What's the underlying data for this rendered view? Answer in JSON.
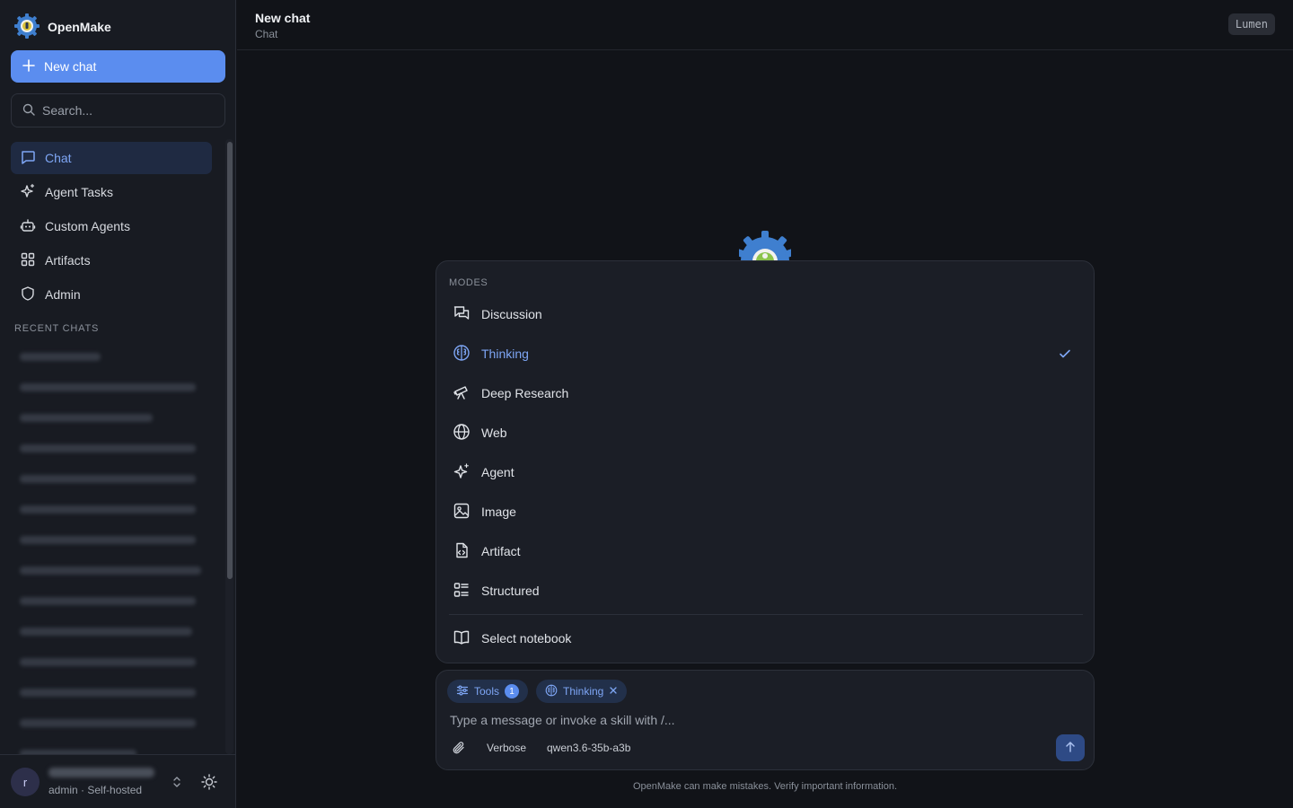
{
  "brand": {
    "name": "OpenMake"
  },
  "sidebar": {
    "new_chat_label": "New chat",
    "search_placeholder": "Search...",
    "nav": [
      {
        "label": "Chat",
        "icon": "chat-bubble-icon",
        "active": true
      },
      {
        "label": "Agent Tasks",
        "icon": "sparkles-icon",
        "active": false
      },
      {
        "label": "Custom Agents",
        "icon": "robot-icon",
        "active": false
      },
      {
        "label": "Artifacts",
        "icon": "grid-icon",
        "active": false
      },
      {
        "label": "Admin",
        "icon": "shield-icon",
        "active": false
      }
    ],
    "recent_label": "RECENT CHATS",
    "user": {
      "initial": "r",
      "subtitle": "admin · Self-hosted"
    }
  },
  "header": {
    "title": "New chat",
    "subtitle": "Chat",
    "theme_badge": "Lumen"
  },
  "modes": {
    "label": "MODES",
    "items": [
      {
        "label": "Discussion",
        "icon": "discussion-icon"
      },
      {
        "label": "Thinking",
        "icon": "brain-icon",
        "selected": true
      },
      {
        "label": "Deep Research",
        "icon": "telescope-icon"
      },
      {
        "label": "Web",
        "icon": "globe-icon"
      },
      {
        "label": "Agent",
        "icon": "sparkles-icon"
      },
      {
        "label": "Image",
        "icon": "image-icon"
      },
      {
        "label": "Artifact",
        "icon": "file-code-icon"
      },
      {
        "label": "Structured",
        "icon": "list-icon"
      }
    ],
    "notebook_label": "Select notebook"
  },
  "composer": {
    "tools_label": "Tools",
    "tools_count": "1",
    "thinking_label": "Thinking",
    "placeholder": "Type a message or invoke a skill with /...",
    "verbose_label": "Verbose",
    "model": "qwen3.6-35b-a3b"
  },
  "disclaimer": "OpenMake can make mistakes. Verify important information.",
  "colors": {
    "accent": "#5b8def",
    "bg": "#111318",
    "sidebar": "#181b22",
    "panel": "#1b1e26"
  }
}
